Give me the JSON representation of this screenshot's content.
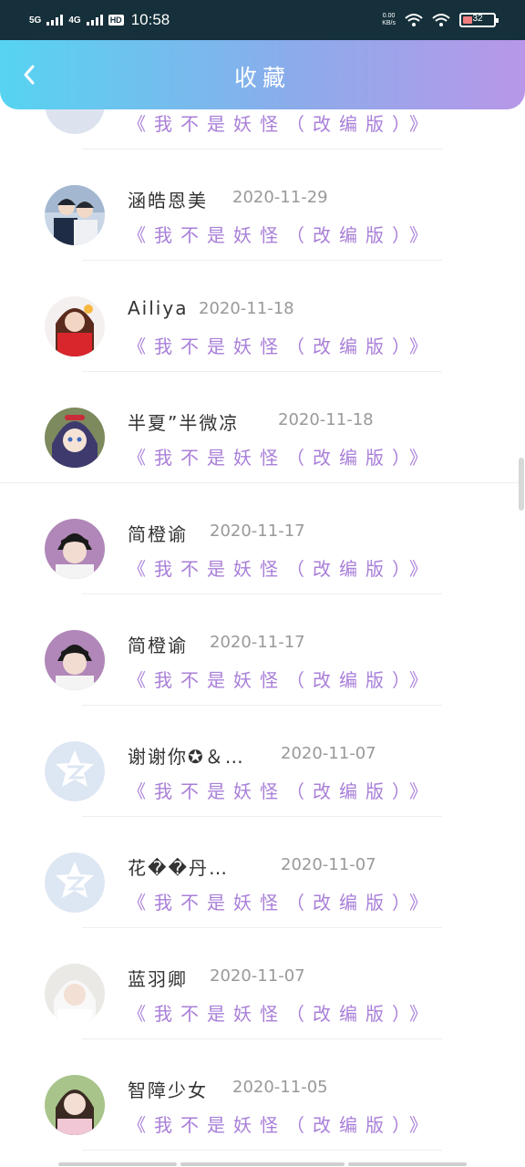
{
  "status_bar": {
    "net1": "5G",
    "net2": "4G",
    "hd": "HD",
    "time": "10:58",
    "speed_value": "0.00",
    "speed_unit": "KB/s",
    "battery": "32"
  },
  "header": {
    "title": "收藏"
  },
  "favorites": [
    {
      "author": "",
      "date": "",
      "book": "《我不是妖怪（改编版）》",
      "avatar": "partial-avatar"
    },
    {
      "author": "涵皓恩美",
      "date": "2020-11-29",
      "book": "《我不是妖怪（改编版）》",
      "avatar": "couple-anime-avatar"
    },
    {
      "author": "Ailiya",
      "date": "2020-11-18",
      "book": "《我不是妖怪（改编版）》",
      "avatar": "girl-red-avatar"
    },
    {
      "author": "半夏”半微凉",
      "date": "2020-11-18",
      "book": "《我不是妖怪（改编版）》",
      "avatar": "anime-girl-avatar"
    },
    {
      "author": "简橙谕",
      "date": "2020-11-17",
      "book": "《我不是妖怪（改编版）》",
      "avatar": "boy-photo-avatar"
    },
    {
      "author": "简橙谕",
      "date": "2020-11-17",
      "book": "《我不是妖怪（改编版）》",
      "avatar": "boy-photo-avatar"
    },
    {
      "author": "谢谢你✪＆…",
      "date": "2020-11-07",
      "book": "《我不是妖怪（改编版）》",
      "avatar": "qzone-default-avatar"
    },
    {
      "author": "花��丹…",
      "date": "2020-11-07",
      "book": "《我不是妖怪（改编版）》",
      "avatar": "qzone-default-avatar"
    },
    {
      "author": "蓝羽卿",
      "date": "2020-11-07",
      "book": "《我不是妖怪（改编版）》",
      "avatar": "white-hair-girl-avatar"
    },
    {
      "author": "智障少女",
      "date": "2020-11-05",
      "book": "《我不是妖怪（改编版）》",
      "avatar": "girl-braids-avatar"
    }
  ],
  "colors": {
    "header_gradient": [
      "#56d4f1",
      "#8aaceb",
      "#b897e8"
    ],
    "book_title": "#a97fd8",
    "author": "#333333",
    "date": "#999999"
  }
}
